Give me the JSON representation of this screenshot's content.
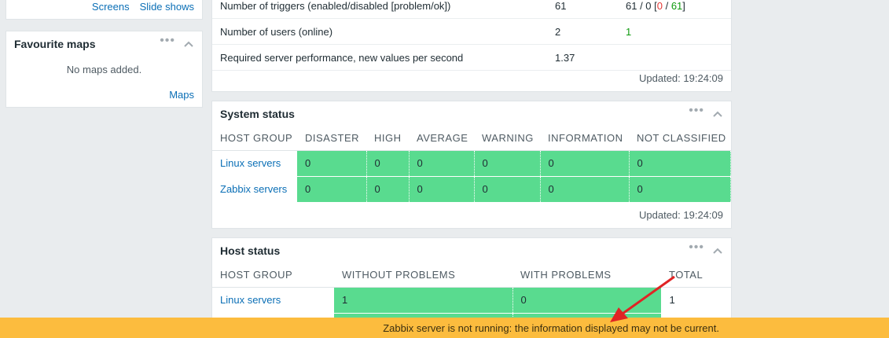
{
  "links_widget": {
    "screens": "Screens",
    "slide_shows": "Slide shows"
  },
  "favourite_maps": {
    "title": "Favourite maps",
    "empty_text": "No maps added.",
    "footer_link": "Maps"
  },
  "info_widget": {
    "rows": [
      {
        "label": "Number of triggers (enabled/disabled [problem/ok])",
        "value": "61",
        "extra_a": "61 / 0 [",
        "extra_red": "0",
        "extra_sep": " / ",
        "extra_green": "61",
        "extra_b": "]"
      },
      {
        "label": "Number of users (online)",
        "value": "2",
        "extra_green": "1"
      },
      {
        "label": "Required server performance, new values per second",
        "value": "1.37"
      }
    ],
    "updated": "Updated: 19:24:09"
  },
  "system_status": {
    "title": "System status",
    "columns": [
      "HOST GROUP",
      "DISASTER",
      "HIGH",
      "AVERAGE",
      "WARNING",
      "INFORMATION",
      "NOT CLASSIFIED"
    ],
    "rows": [
      {
        "group": "Linux servers",
        "values": [
          "0",
          "0",
          "0",
          "0",
          "0",
          "0"
        ]
      },
      {
        "group": "Zabbix servers",
        "values": [
          "0",
          "0",
          "0",
          "0",
          "0",
          "0"
        ]
      }
    ],
    "updated": "Updated: 19:24:09"
  },
  "host_status": {
    "title": "Host status",
    "columns": [
      "HOST GROUP",
      "WITHOUT PROBLEMS",
      "WITH PROBLEMS",
      "TOTAL"
    ],
    "rows": [
      {
        "group": "Linux servers",
        "without": "1",
        "with": "0",
        "total": "1"
      }
    ]
  },
  "banner": {
    "text": "Zabbix server is not running: the information displayed may not be current."
  },
  "colors": {
    "ok_green": "#59db8f",
    "banner": "#fcbc3e",
    "link": "#0b6fb6",
    "arrow": "#e02424"
  }
}
